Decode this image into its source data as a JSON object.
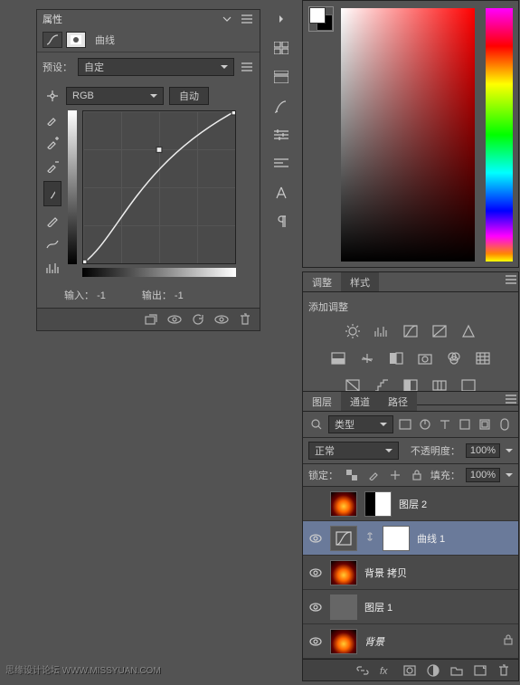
{
  "props": {
    "title": "属性",
    "adj_name": "曲线",
    "preset_label": "预设：",
    "preset_value": "自定",
    "channel": "RGB",
    "auto": "自动",
    "input_label": "输入：",
    "input_value": "-1",
    "output_label": "输出：",
    "output_value": "-1"
  },
  "chart_data": {
    "type": "line",
    "title": "曲线",
    "xlabel": "输入",
    "ylabel": "输出",
    "xlim": [
      0,
      255
    ],
    "ylim": [
      0,
      255
    ],
    "series": [
      {
        "name": "RGB",
        "x": [
          0,
          64,
          128,
          255
        ],
        "y": [
          0,
          115,
          195,
          255
        ]
      }
    ]
  },
  "adj": {
    "tab1": "调整",
    "tab2": "样式",
    "heading": "添加调整"
  },
  "layers": {
    "tab1": "图层",
    "tab2": "通道",
    "tab3": "路径",
    "kind_label": "类型",
    "blend": "正常",
    "opacity_label": "不透明度：",
    "opacity_value": "100%",
    "lock_label": "锁定：",
    "fill_label": "填充：",
    "fill_value": "100%",
    "items": [
      {
        "name": "图层 2",
        "thumb": "fire",
        "mask": true,
        "visible": false,
        "locked": false,
        "selected": false
      },
      {
        "name": "曲线 1",
        "thumb": "adj",
        "mask": true,
        "visible": true,
        "locked": false,
        "selected": true
      },
      {
        "name": "背景 拷贝",
        "thumb": "fire",
        "mask": false,
        "visible": true,
        "locked": false,
        "selected": false
      },
      {
        "name": "图层 1",
        "thumb": "gray",
        "mask": false,
        "visible": true,
        "locked": false,
        "selected": false
      },
      {
        "name": "背景",
        "thumb": "fire",
        "mask": false,
        "visible": true,
        "locked": true,
        "selected": false
      }
    ]
  },
  "strip_icons": [
    "tabs-icon",
    "swatches-icon",
    "props-icon",
    "brush-icon",
    "adjust-icon",
    "paragraph-icon",
    "type-icon",
    "pilcrow-icon"
  ],
  "watermark": "思缘设计论坛 WWW.MISSYUAN.COM"
}
